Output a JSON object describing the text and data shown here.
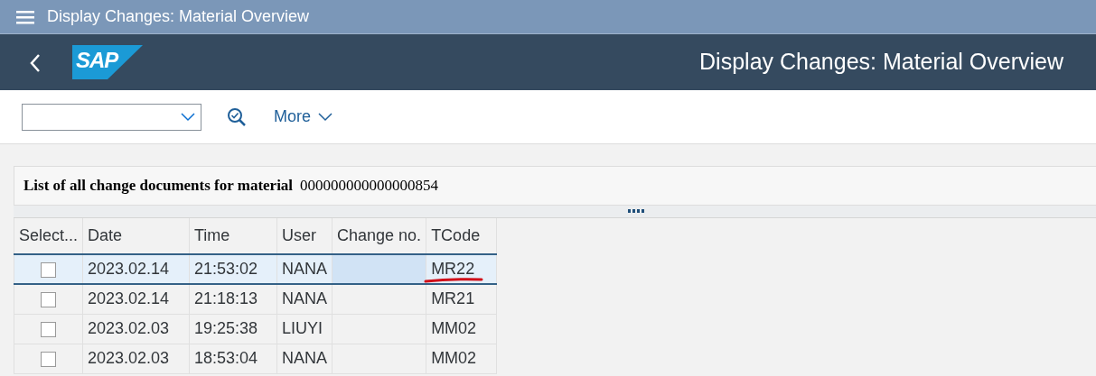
{
  "window": {
    "title": "Display Changes: Material Overview"
  },
  "shell": {
    "title": "Display Changes: Material Overview",
    "logo": "SAP"
  },
  "toolbar": {
    "more": "More"
  },
  "header": {
    "label": "List of all change documents for material",
    "material": "000000000000000854"
  },
  "table": {
    "columns": [
      "Select...",
      "Date",
      "Time",
      "User",
      "Change no.",
      "TCode"
    ],
    "rows": [
      {
        "selected": true,
        "checked": false,
        "date": "2023.02.14",
        "time": "21:53:02",
        "user": "NANA",
        "tcode": "MR22",
        "underlined": true
      },
      {
        "selected": false,
        "checked": false,
        "date": "2023.02.14",
        "time": "21:18:13",
        "user": "NANA",
        "tcode": "MR21",
        "underlined": false
      },
      {
        "selected": false,
        "checked": false,
        "date": "2023.02.03",
        "time": "19:25:38",
        "user": "LIUYI",
        "tcode": "MM02",
        "underlined": false
      },
      {
        "selected": false,
        "checked": false,
        "date": "2023.02.03",
        "time": "18:53:04",
        "user": "NANA",
        "tcode": "MM02",
        "underlined": false
      }
    ]
  }
}
